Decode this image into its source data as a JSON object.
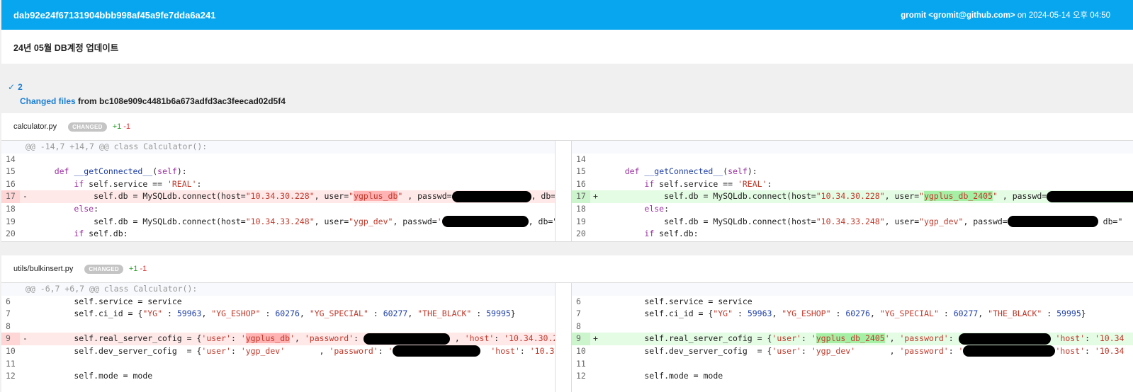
{
  "commit": {
    "hash": "dab92e24f67131904bbb998af45a9fe7dda6a241",
    "author": "gromit <gromit@github.com>",
    "date_prefix": "on",
    "date": "2024-05-14 오후 04:50",
    "message": "24년 05월 DB계정 업데이트"
  },
  "summary": {
    "count": "2",
    "changed_files_label": "Changed files",
    "from_label": "from",
    "base_hash": "bc108e909c4481b6a673adfd3ac3feecad02d5f4"
  },
  "files": [
    {
      "name": "calculator.py",
      "badge": "CHANGED",
      "additions": "+1",
      "deletions": "-1",
      "hunk": "@@ -14,7 +14,7 @@ class Calculator():",
      "left_lines": [
        "14",
        "15",
        "16",
        "17",
        "18",
        "19",
        "20"
      ],
      "right_lines": [
        "14",
        "15",
        "16",
        "17",
        "18",
        "19",
        "20"
      ]
    },
    {
      "name": "utils/bulkinsert.py",
      "badge": "CHANGED",
      "additions": "+1",
      "deletions": "-1",
      "hunk": "@@ -6,7 +6,7 @@ class Calculator():",
      "left_lines": [
        "6",
        "7",
        "8",
        "9",
        "10",
        "11",
        "12"
      ],
      "right_lines": [
        "6",
        "7",
        "8",
        "9",
        "10",
        "11",
        "12"
      ]
    }
  ],
  "colors": {
    "header_bg": "#08a6ef",
    "link": "#1a7fd4",
    "added": "#2ca02c",
    "removed": "#dd3333"
  }
}
